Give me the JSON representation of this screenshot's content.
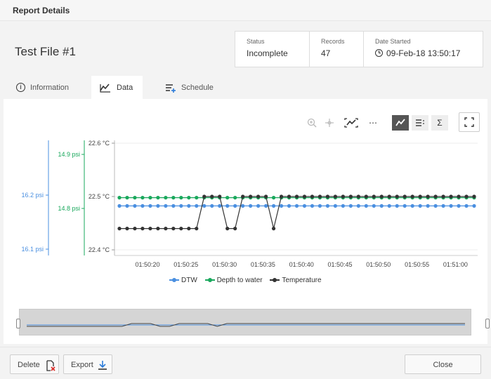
{
  "window": {
    "title": "Report Details"
  },
  "file": {
    "title": "Test File #1"
  },
  "stats": [
    {
      "label": "Status",
      "value": "Incomplete"
    },
    {
      "label": "Records",
      "value": "47"
    },
    {
      "label": "Date Started",
      "value": "09-Feb-18 13:50:17"
    }
  ],
  "tabs": [
    {
      "label": "Information",
      "icon": "info-icon",
      "active": false
    },
    {
      "label": "Data",
      "icon": "chart-icon",
      "active": true
    },
    {
      "label": "Schedule",
      "icon": "schedule-add-icon",
      "active": false
    }
  ],
  "toolbar": {
    "zoom": {
      "icon": "zoom-in-icon"
    },
    "pan": {
      "icon": "pan-icon"
    },
    "autoscale": {
      "icon": "autoscale-icon"
    },
    "more": {
      "glyph": "⋯",
      "icon": "more-icon"
    },
    "line_mode": {
      "icon": "line-chart-icon"
    },
    "list_mode": {
      "icon": "list-icon"
    },
    "sum_mode": {
      "glyph": "Σ",
      "icon": "sigma-icon"
    },
    "fullscreen": {
      "icon": "fullscreen-icon"
    }
  },
  "colors": {
    "dtw": "#4a8fe0",
    "depth": "#19a85c",
    "temperature": "#333333"
  },
  "chart_data": {
    "type": "line",
    "x_ticks": [
      "01:50:20",
      "01:50:25",
      "01:50:30",
      "01:50:35",
      "01:50:40",
      "01:50:45",
      "01:50:50",
      "01:50:55",
      "01:51:00"
    ],
    "axes": {
      "temperature": {
        "ticks": [
          "22.6 °C",
          "22.5 °C",
          "22.4 °C"
        ],
        "ylim": [
          22.4,
          22.6
        ]
      },
      "depth": {
        "ticks": [
          "14.9 psi",
          "14.8 psi"
        ]
      },
      "dtw": {
        "ticks": [
          "16.2 psi",
          "16.1 psi"
        ]
      }
    },
    "series": [
      {
        "name": "DTW",
        "axis": "dtw",
        "values": [
          16.18,
          16.18,
          16.18,
          16.18,
          16.18,
          16.18,
          16.18,
          16.18,
          16.18,
          16.18,
          16.18,
          16.18,
          16.18,
          16.18,
          16.18,
          16.18,
          16.18,
          16.18,
          16.18,
          16.18,
          16.18,
          16.18,
          16.18,
          16.18,
          16.18,
          16.18,
          16.18,
          16.18,
          16.18,
          16.18,
          16.18,
          16.18,
          16.18,
          16.18,
          16.18,
          16.18,
          16.18,
          16.18,
          16.18,
          16.18,
          16.18,
          16.18,
          16.18,
          16.18,
          16.18,
          16.18,
          16.18
        ]
      },
      {
        "name": "Depth to water",
        "axis": "depth",
        "values": [
          14.82,
          14.82,
          14.82,
          14.82,
          14.82,
          14.82,
          14.82,
          14.82,
          14.82,
          14.82,
          14.82,
          14.82,
          14.82,
          14.82,
          14.82,
          14.82,
          14.82,
          14.82,
          14.82,
          14.82,
          14.82,
          14.82,
          14.82,
          14.82,
          14.82,
          14.82,
          14.82,
          14.82,
          14.82,
          14.82,
          14.82,
          14.82,
          14.82,
          14.82,
          14.82,
          14.82,
          14.82,
          14.82,
          14.82,
          14.82,
          14.82,
          14.82,
          14.82,
          14.82,
          14.82,
          14.82,
          14.82
        ]
      },
      {
        "name": "Temperature",
        "axis": "temperature",
        "values": [
          22.44,
          22.44,
          22.44,
          22.44,
          22.44,
          22.44,
          22.44,
          22.44,
          22.44,
          22.44,
          22.44,
          22.5,
          22.5,
          22.5,
          22.44,
          22.44,
          22.5,
          22.5,
          22.5,
          22.5,
          22.44,
          22.5,
          22.5,
          22.5,
          22.5,
          22.5,
          22.5,
          22.5,
          22.5,
          22.5,
          22.5,
          22.5,
          22.5,
          22.5,
          22.5,
          22.5,
          22.5,
          22.5,
          22.5,
          22.5,
          22.5,
          22.5,
          22.5,
          22.5,
          22.5,
          22.5,
          22.5
        ]
      }
    ],
    "legend_position": "bottom-center"
  },
  "footer": {
    "delete_label": "Delete",
    "export_label": "Export",
    "close_label": "Close"
  }
}
